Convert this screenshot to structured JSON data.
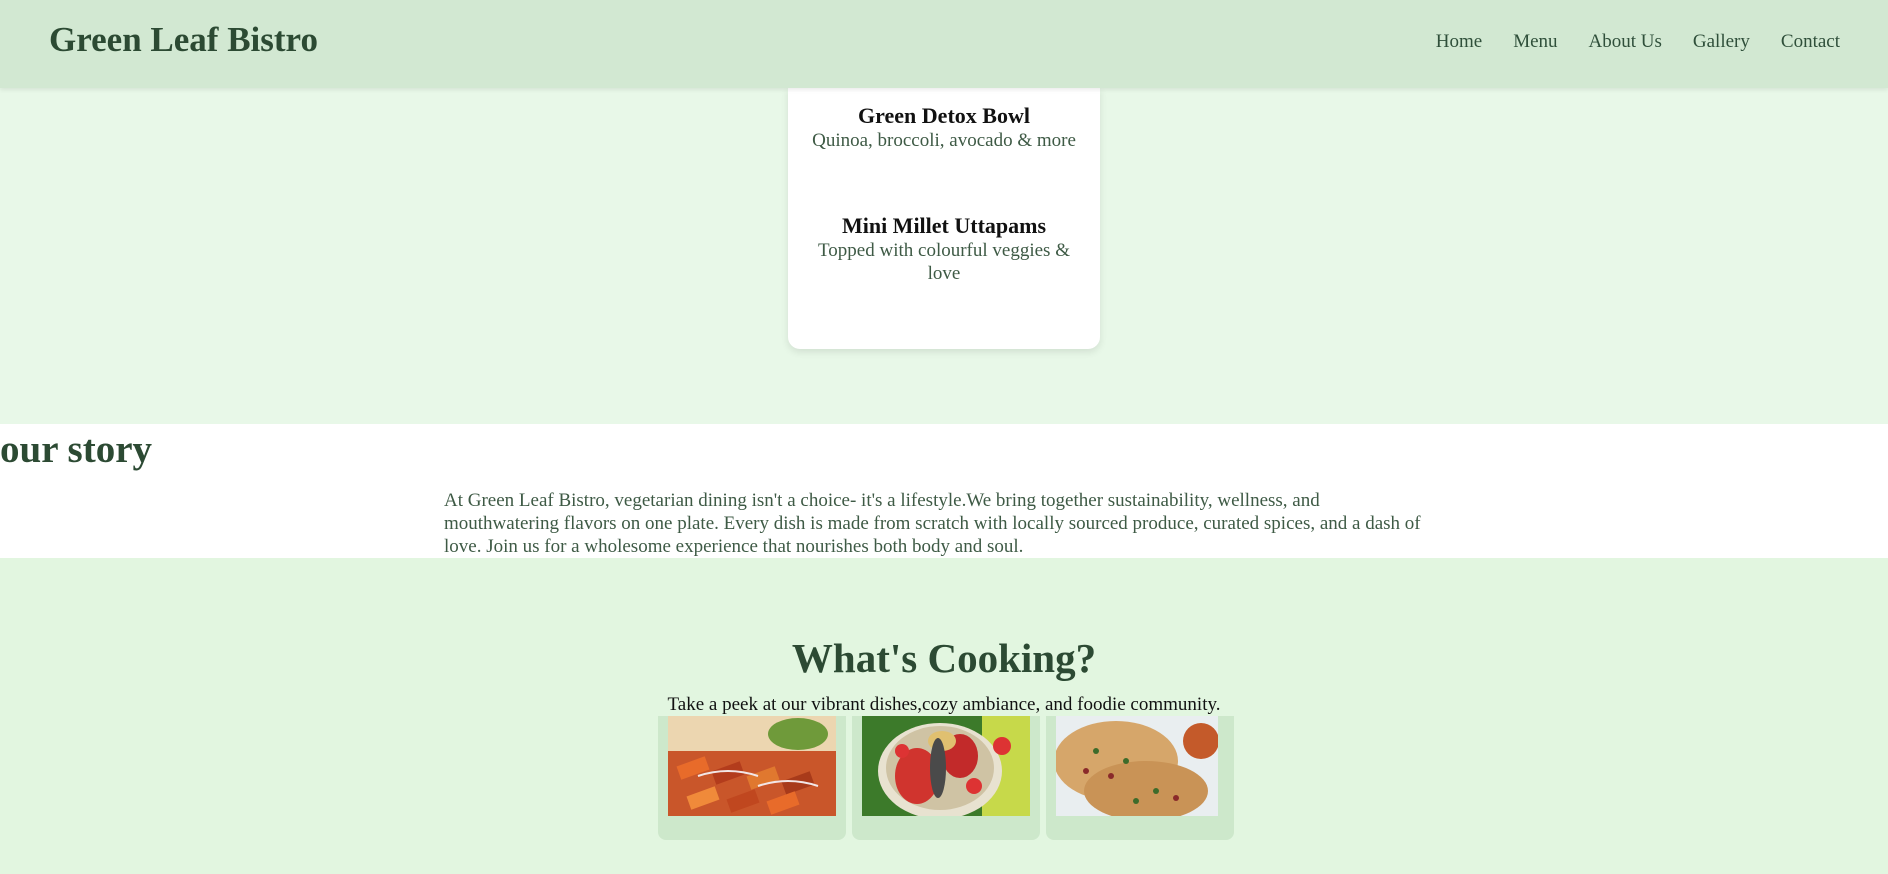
{
  "header": {
    "brand": "Green Leaf Bistro",
    "nav": [
      "Home",
      "Menu",
      "About Us",
      "Gallery",
      "Contact"
    ]
  },
  "menu": {
    "dishes": [
      {
        "name": "Green Detox Bowl",
        "description": "Quinoa, broccoli, avocado & more"
      },
      {
        "name": "Mini Millet Uttapams",
        "description": "Topped with colourful veggies & love"
      }
    ]
  },
  "story": {
    "title": "our story",
    "text": "At Green Leaf Bistro, vegetarian dining isn't a choice- it's a lifestyle.We bring together sustainability, wellness, and mouthwatering flavors on one plate. Every dish is made from scratch with locally sourced produce, curated spices, and a dash of love. Join us for a wholesome experience that nourishes both body and soul."
  },
  "cooking": {
    "title": "What's Cooking?",
    "subtitle": "Take a peek at our vibrant dishes,cozy ambiance, and foodie community."
  },
  "colors": {
    "header_bg": "#d2e8d2",
    "page_bg": "#e8f8e8",
    "accent_text": "#2c4a33"
  }
}
